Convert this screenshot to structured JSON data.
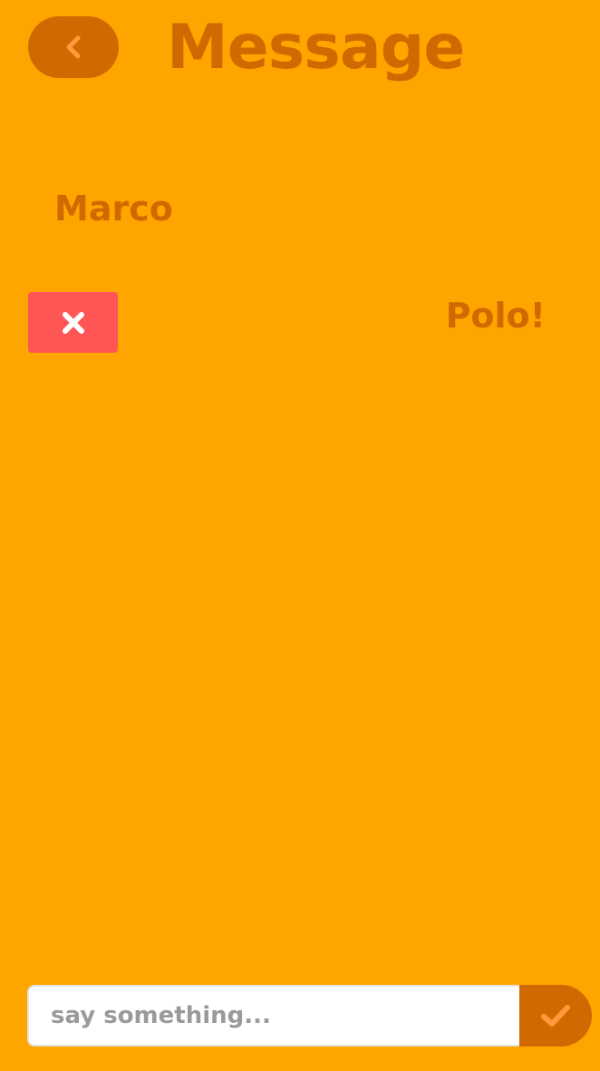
{
  "header": {
    "title": "Message",
    "back_icon": "chevron-left-icon"
  },
  "messages": [
    {
      "text": "Marco",
      "direction": "received"
    },
    {
      "text": "Polo!",
      "direction": "sent",
      "action_icon": "close-icon"
    }
  ],
  "composer": {
    "placeholder": "say something...",
    "value": "",
    "send_icon": "checkmark-icon"
  },
  "colors": {
    "background": "#FFA500",
    "accent_dark": "#D06A00",
    "icon_light": "#FF9A3C",
    "delete": "#FF5555",
    "input_background": "#FFFFFF",
    "placeholder": "#9A9A9A"
  }
}
